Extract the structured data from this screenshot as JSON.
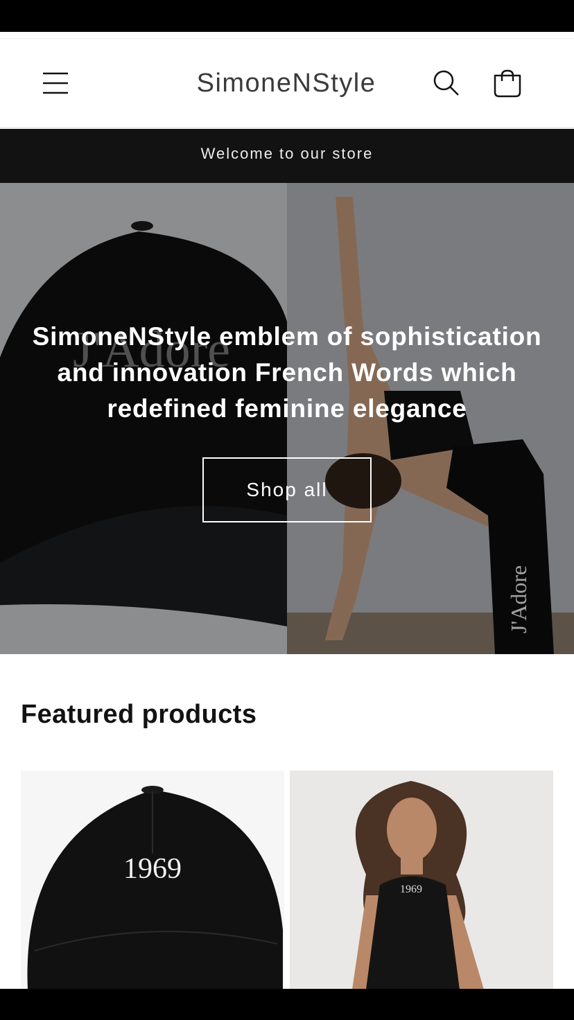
{
  "header": {
    "logo": "SimoneNStyle",
    "menu_icon": "menu-icon",
    "search_icon": "search-icon",
    "cart_icon": "cart-icon"
  },
  "announcement": {
    "text": "Welcome to our store"
  },
  "hero": {
    "heading": "SimoneNStyle emblem of sophistication and innovation French Words which redefined feminine elegance",
    "button_label": "Shop all",
    "left_image_text": "J'Adore",
    "right_image_text": "J'Adore"
  },
  "featured": {
    "heading": "Featured products",
    "products": [
      {
        "image_text": "1969"
      },
      {
        "image_text": "1969"
      }
    ]
  },
  "colors": {
    "background": "#ffffff",
    "text": "#121212",
    "announcement_bg": "#121212",
    "status_bar": "#000000"
  }
}
